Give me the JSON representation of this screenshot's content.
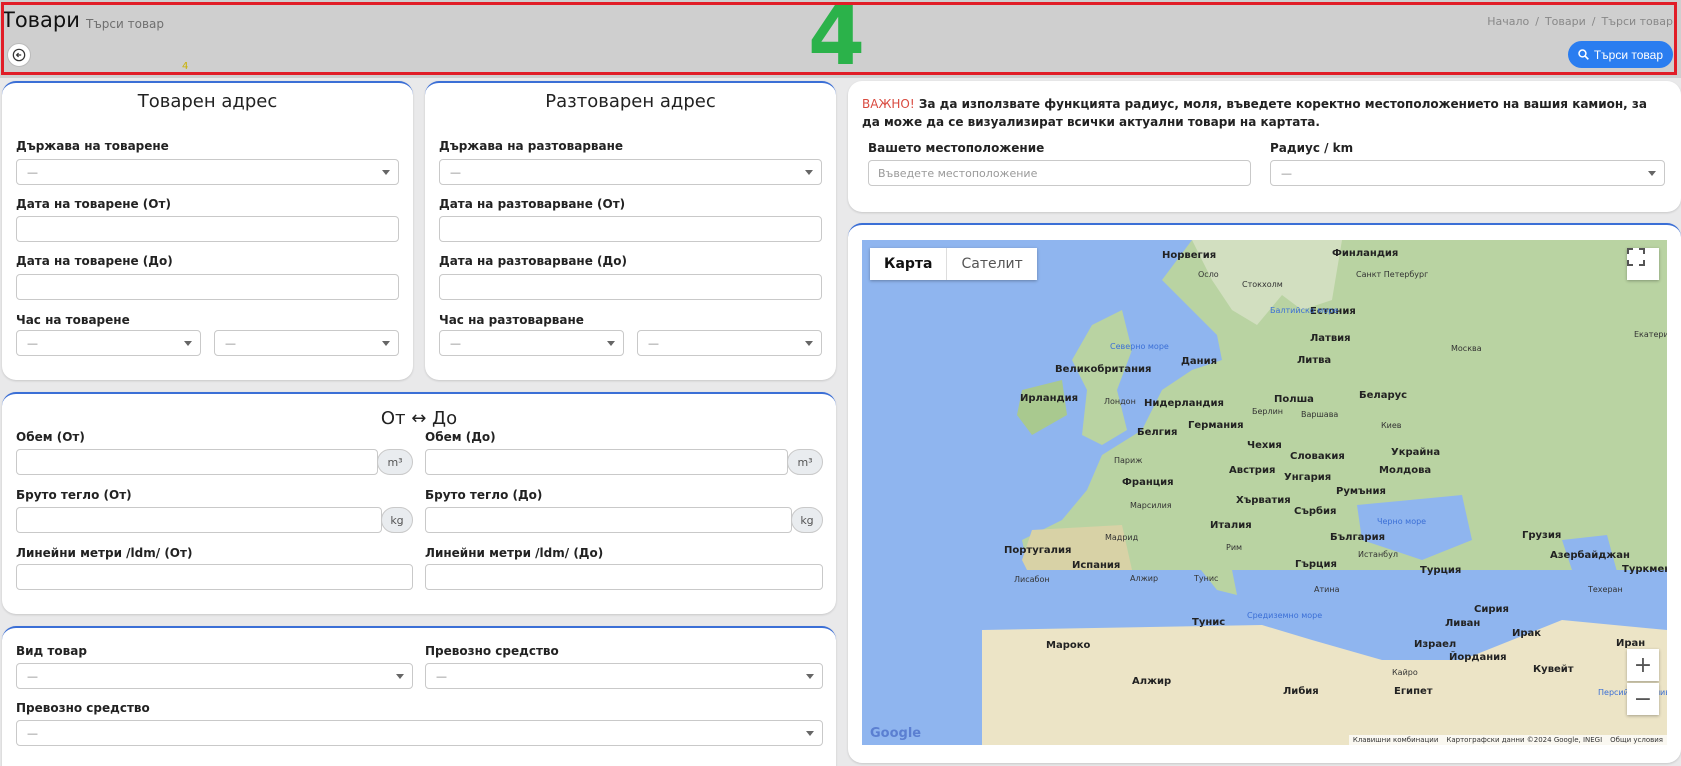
{
  "header": {
    "title": "Товари",
    "subtitle": "Търси товар",
    "annotation_big": "4",
    "annotation_small": "4",
    "breadcrumb": [
      "Начало",
      "Товари",
      "Търси товар"
    ],
    "search_button": "Търси товар",
    "accent": "#2a7df0",
    "highlight": "#e11d27"
  },
  "loading": {
    "title": "Товарен адрес",
    "country_label": "Държава на товарене",
    "country_value": "—",
    "date_from_label": "Дата на товарене (От)",
    "date_to_label": "Дата на товарене (До)",
    "time_label": "Час на товарене",
    "time_from_value": "—",
    "time_to_value": "—"
  },
  "unloading": {
    "title": "Разтоварен адрес",
    "country_label": "Държава на разтоварване",
    "country_value": "—",
    "date_from_label": "Дата на разтоварване (От)",
    "date_to_label": "Дата на разтоварване (До)",
    "time_label": "Час на разтоварване",
    "time_from_value": "—",
    "time_to_value": "—"
  },
  "range": {
    "title": "От ↔ До",
    "volume_from_label": "Обем (От)",
    "volume_to_label": "Обем (До)",
    "volume_unit": "m³",
    "weight_from_label": "Бруто тегло (От)",
    "weight_to_label": "Бруто тегло (До)",
    "weight_unit": "kg",
    "ldm_from_label": "Линейни метри /ldm/ (От)",
    "ldm_to_label": "Линейни метри /ldm/ (До)"
  },
  "cargo": {
    "type_label": "Вид товар",
    "type_value": "—",
    "vehicle_label": "Превозно средство",
    "vehicle_value": "—",
    "vehicle2_label": "Превозно средство",
    "vehicle2_value": "—"
  },
  "radius": {
    "important": "ВАЖНО!",
    "notice": "За да използвате функцията радиус, моля, въведете коректно местоположението на вашия камион, за да може да се визуализират всички актуални товари на картата.",
    "location_label": "Вашето местоположение",
    "location_placeholder": "Въведете местоположение",
    "radius_label": "Радиус / km",
    "radius_value": "—"
  },
  "map": {
    "tab_map": "Карта",
    "tab_satellite": "Сателит",
    "zoom_in": "+",
    "zoom_out": "−",
    "logo": "Google",
    "footer_shortcuts": "Клавишни комбинации",
    "footer_data": "Картографски данни ©2024 Google, INEGI",
    "footer_terms": "Общи условия",
    "countries": [
      "Норвегия",
      "Финландия",
      "Естония",
      "Латвия",
      "Дания",
      "Литва",
      "Великобритания",
      "Ирландия",
      "Нидерландия",
      "Полша",
      "Беларус",
      "Белгия",
      "Германия",
      "Чехия",
      "Словакия",
      "Украйна",
      "Франция",
      "Австрия",
      "Унгария",
      "Молдова",
      "Румъния",
      "Хърватия",
      "Сърбия",
      "България",
      "Италия",
      "Гърция",
      "Португалия",
      "Испания",
      "Турция",
      "Грузия",
      "Азербайджан",
      "Туркменистан",
      "Тунис",
      "Мароко",
      "Алжир",
      "Либия",
      "Египет",
      "Израел",
      "Йордания",
      "Ливан",
      "Сирия",
      "Ирак",
      "Кувейт",
      "Иран"
    ],
    "cities": [
      "Осло",
      "Стокхолм",
      "Санкт Петербург",
      "Москва",
      "Екатеринбург",
      "Лондон",
      "Париж",
      "Берлин",
      "Варшава",
      "Киев",
      "Марсилия",
      "Мадрид",
      "Лисабон",
      "Рим",
      "Атина",
      "Истанбул",
      "Алжир",
      "Тунис",
      "Техеран",
      "Кайро"
    ],
    "seas": [
      "Северно море",
      "Балтийско море",
      "Черно море",
      "Средиземно море",
      "Персийски залив"
    ]
  }
}
